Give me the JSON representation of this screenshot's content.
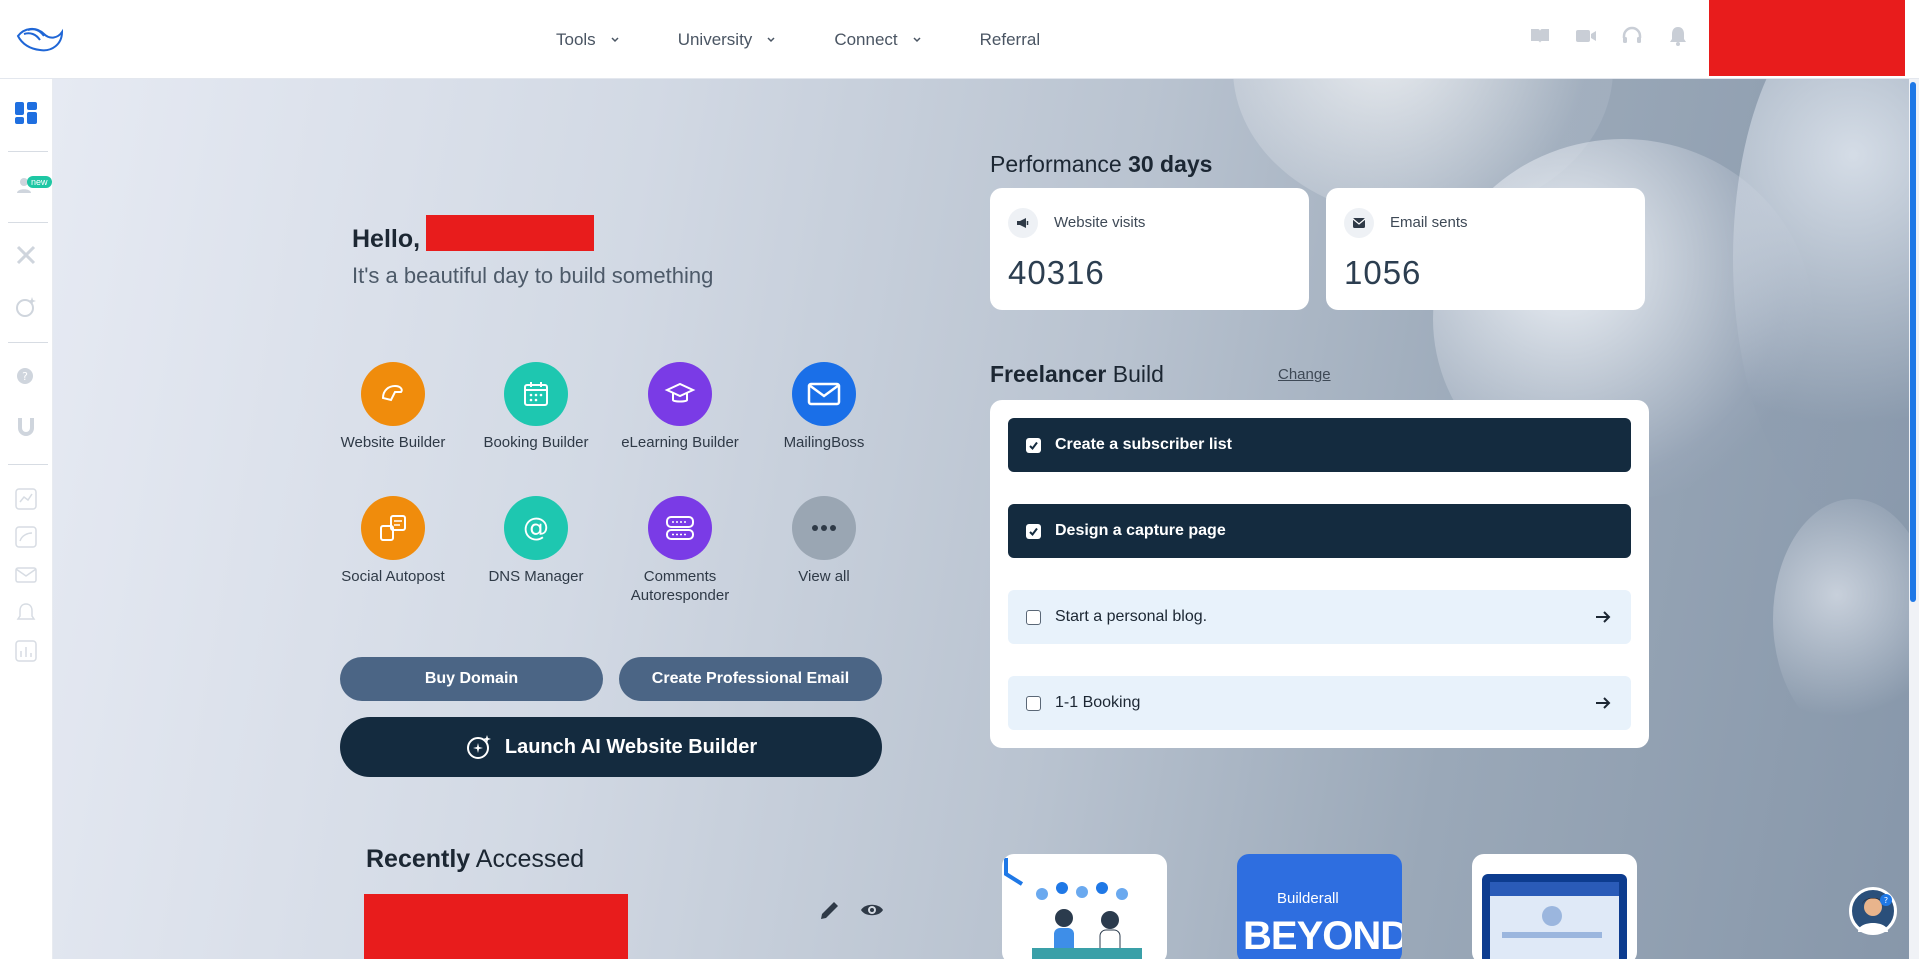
{
  "nav": {
    "items": [
      {
        "label": "Tools",
        "dropdown": true
      },
      {
        "label": "University",
        "dropdown": true
      },
      {
        "label": "Connect",
        "dropdown": true
      },
      {
        "label": "Referral",
        "dropdown": false
      }
    ]
  },
  "top_icons": [
    "book-icon",
    "video-icon",
    "headset-icon",
    "bell-icon"
  ],
  "sidebar": {
    "new_badge": "new",
    "icons": [
      "dashboard-icon",
      "user-new-icon",
      "tools-cross-icon",
      "ai-sparkle-icon",
      "help-search-icon",
      "magnet-icon",
      "analytics-icon",
      "website-icon",
      "mail-icon",
      "notification-icon",
      "chart-icon"
    ]
  },
  "greeting": {
    "hello": "Hello,",
    "subtitle": "It's a beautiful day to build something"
  },
  "apps": [
    {
      "label": "Website Builder",
      "color": "#f08c0c",
      "icon": "website-builder-icon"
    },
    {
      "label": "Booking Builder",
      "color": "#1ec7b0",
      "icon": "calendar-icon"
    },
    {
      "label": "eLearning Builder",
      "color": "#7a3be6",
      "icon": "graduation-cap-icon"
    },
    {
      "label": "MailingBoss",
      "color": "#1a6fe8",
      "icon": "envelope-icon"
    },
    {
      "label": "Social Autopost",
      "color": "#f08c0c",
      "icon": "social-autopost-icon"
    },
    {
      "label": "DNS Manager",
      "color": "#1ec7b0",
      "icon": "at-sign-icon"
    },
    {
      "label": "Comments Autoresponder",
      "color": "#7a3be6",
      "icon": "comments-icon"
    },
    {
      "label": "View all",
      "color": "#9aa6b3",
      "icon": "more-dots-icon"
    }
  ],
  "buttons": {
    "buy_domain": "Buy Domain",
    "create_email": "Create Professional Email",
    "launch_ai": "Launch AI Website Builder"
  },
  "recent": {
    "title_bold": "Recently",
    "title_rest": "Accessed"
  },
  "performance": {
    "title": "Performance",
    "period": "30 days",
    "stats": [
      {
        "label": "Website visits",
        "value": "40316"
      },
      {
        "label": "Email sents",
        "value": "1056"
      }
    ]
  },
  "freelancer": {
    "title_bold": "Freelancer",
    "title_rest": "Build",
    "change": "Change",
    "tasks": [
      {
        "label": "Create a subscriber list",
        "done": true
      },
      {
        "label": "Design a capture page",
        "done": true
      },
      {
        "label": "Start a personal blog.",
        "done": false
      },
      {
        "label": "1-1 Booking",
        "done": false
      }
    ]
  },
  "thumbnails": [
    {
      "label": ""
    },
    {
      "brand": "Builderall",
      "headline": "BEYOND"
    },
    {
      "label": ""
    }
  ]
}
